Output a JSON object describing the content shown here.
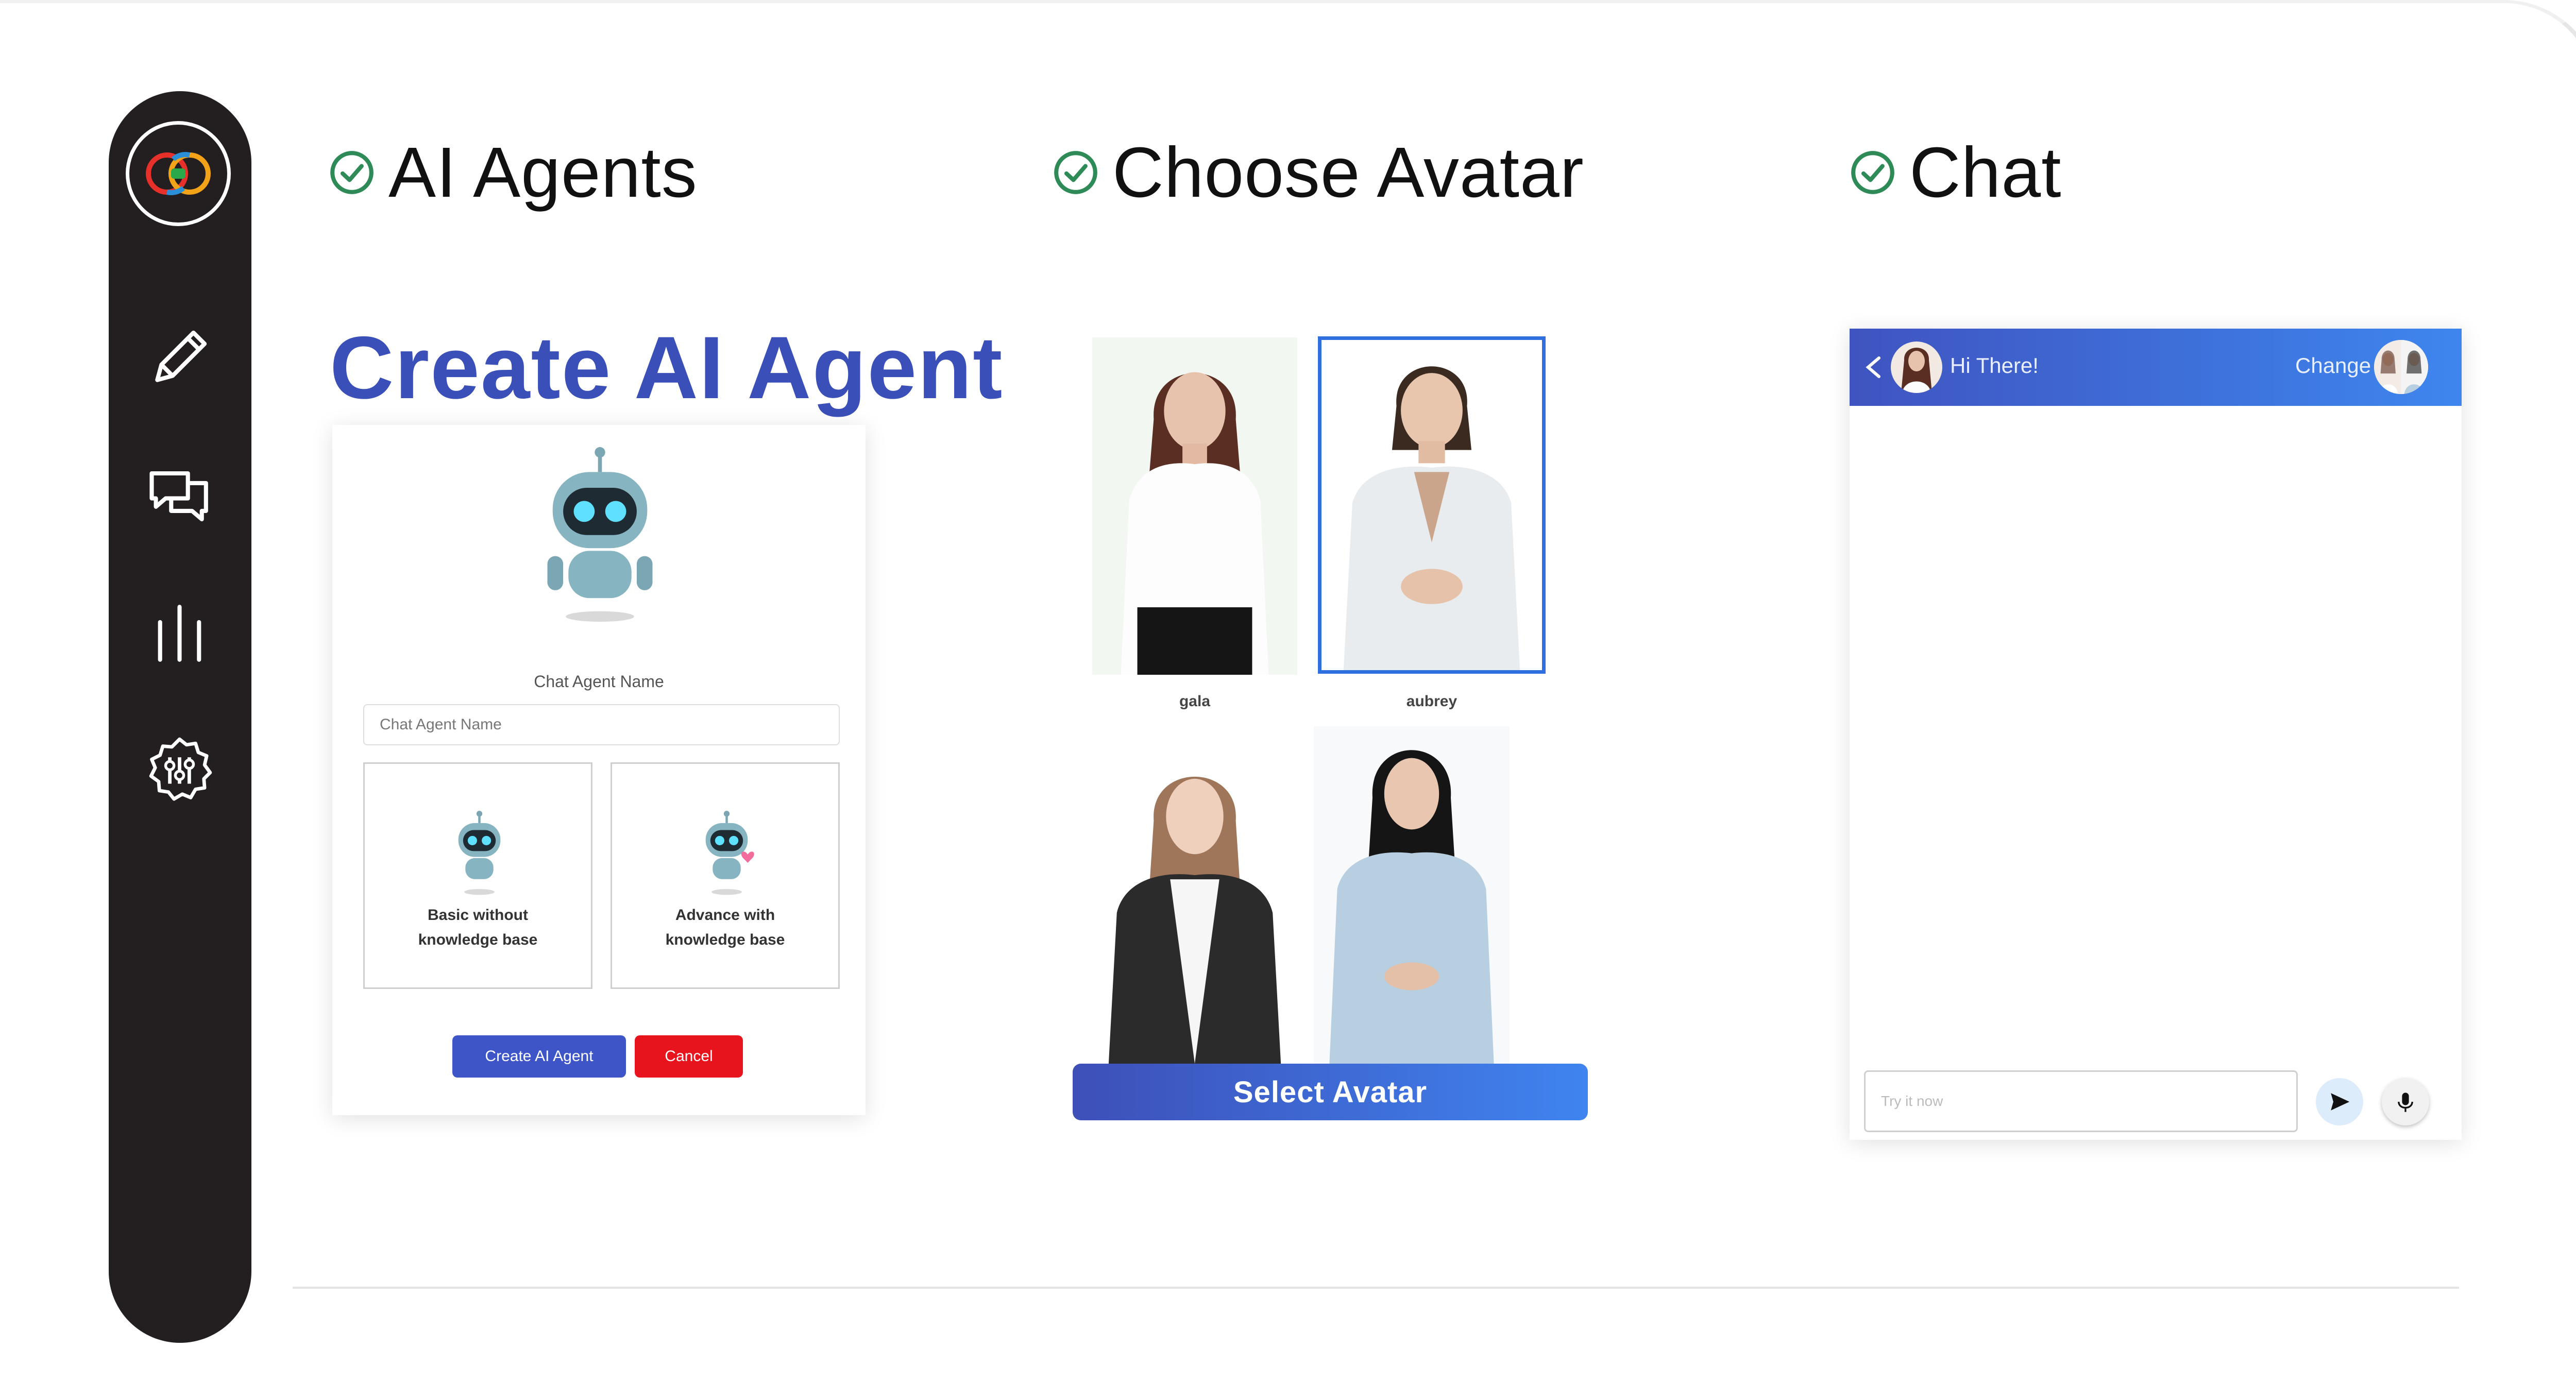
{
  "steps": [
    {
      "label": "AI Agents"
    },
    {
      "label": "Choose Avatar"
    },
    {
      "label": "Chat"
    }
  ],
  "sidebar": {
    "items": [
      {
        "icon": "pencil-icon"
      },
      {
        "icon": "chat-bubbles-icon"
      },
      {
        "icon": "bars-icon"
      },
      {
        "icon": "settings-sliders-icon"
      }
    ]
  },
  "create_agent": {
    "title": "Create AI Agent",
    "name_label": "Chat Agent Name",
    "name_placeholder": "Chat Agent Name",
    "option_basic": "Basic without\nknowledge base",
    "option_advance": "Advance with\nknowledge base",
    "create_label": "Create AI Agent",
    "cancel_label": "Cancel"
  },
  "avatars": {
    "items": [
      {
        "name": "gala",
        "selected": false
      },
      {
        "name": "aubrey",
        "selected": true
      },
      {
        "name": "",
        "selected": false
      },
      {
        "name": "",
        "selected": false
      }
    ],
    "select_label": "Select Avatar"
  },
  "chat": {
    "greeting": "Hi There!",
    "change_label": "Change",
    "input_placeholder": "Try it now"
  },
  "colors": {
    "accent": "#3a50b8",
    "sidebar": "#231f20",
    "check": "#2e8b57",
    "cancel": "#e8141d",
    "selected_border": "#2f6fe0"
  }
}
